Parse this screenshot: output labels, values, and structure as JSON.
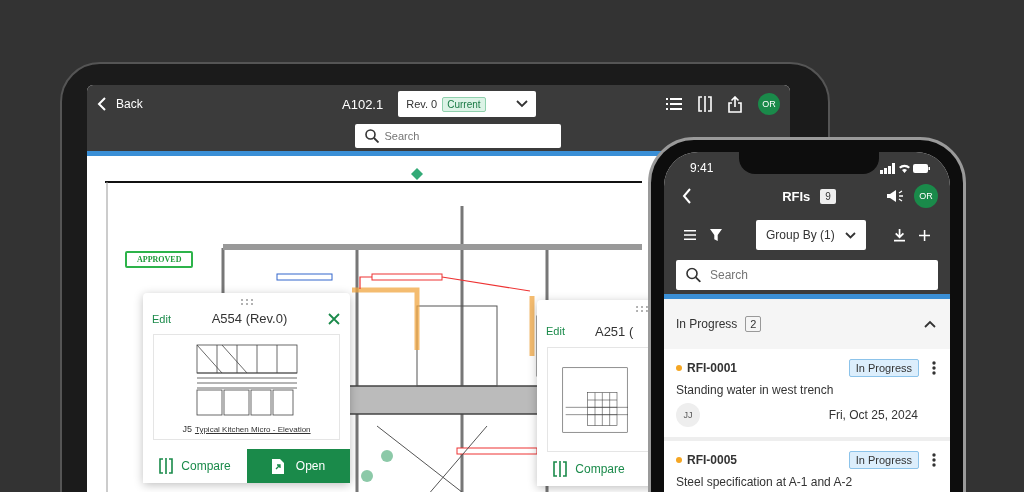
{
  "tablet": {
    "header": {
      "back_label": "Back",
      "sheet": "A102.1",
      "revision": "Rev. 0",
      "revision_badge": "Current",
      "search": {
        "placeholder": "Search"
      },
      "avatar": "OR"
    },
    "drawing": {
      "stamp": "APPROVED"
    },
    "cards": [
      {
        "edit": "Edit",
        "title": "A554 (Rev.0)",
        "closable": true,
        "kind": "elevation",
        "sheet_number": "J5",
        "sheet_title": "Typical Kitchen Micro - Elevation",
        "compare": "Compare",
        "open": "Open"
      },
      {
        "edit": "Edit",
        "title": "A251 (",
        "closable": false,
        "kind": "building",
        "compare": "Compare"
      }
    ]
  },
  "phone": {
    "time": "9:41",
    "title": "RFIs",
    "count": "9",
    "avatar": "OR",
    "group_by": "Group By (1)",
    "search": {
      "placeholder": "Search"
    },
    "section": {
      "title": "In Progress",
      "count": "2",
      "expanded": true
    },
    "rfis": [
      {
        "id": "RFI-0001",
        "color": "#f5a623",
        "status": "In Progress",
        "title": "Standing water in west trench",
        "assignee": "JJ",
        "date": "Fri, Oct 25, 2024"
      },
      {
        "id": "RFI-0005",
        "color": "#f5a623",
        "status": "In Progress",
        "title": "Steel specification at A-1 and A-2"
      }
    ]
  }
}
